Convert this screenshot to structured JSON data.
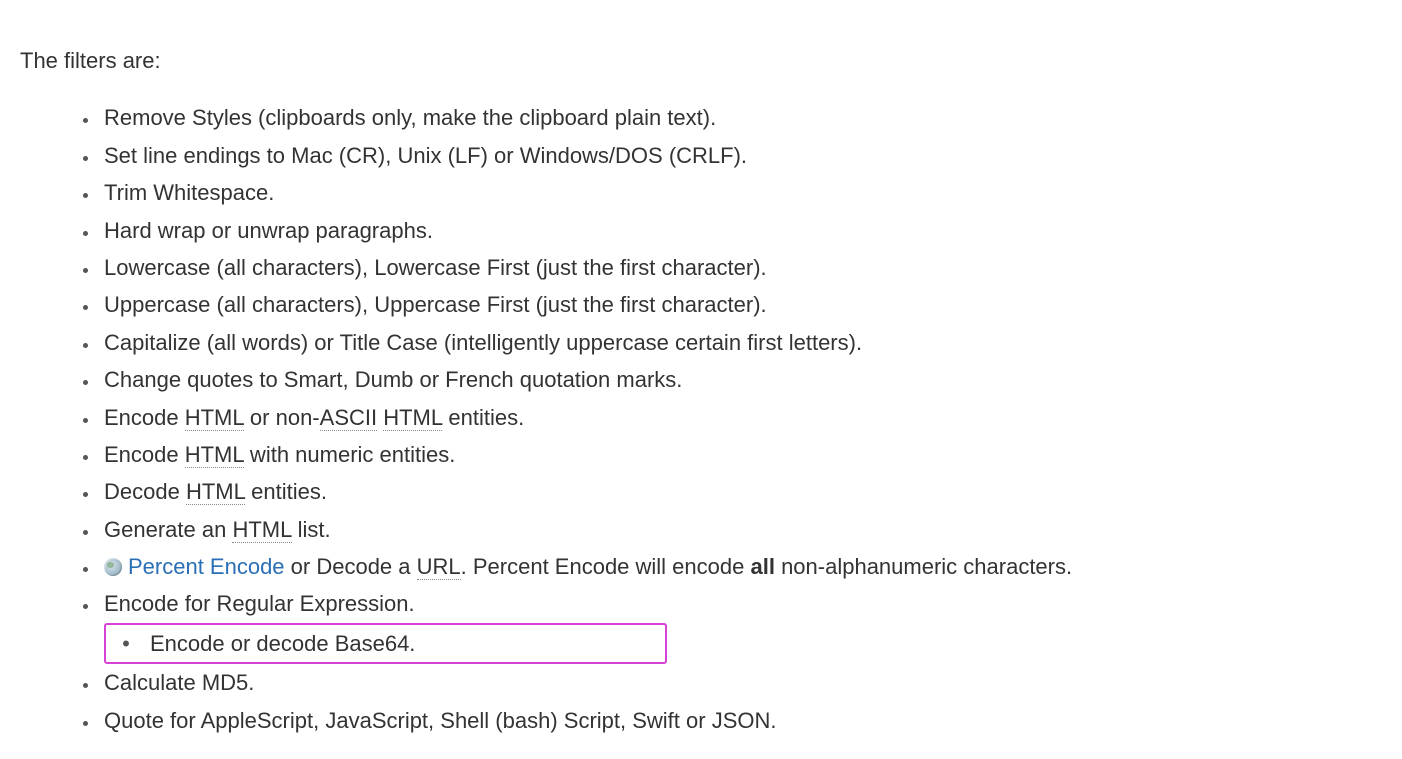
{
  "intro": "The filters are:",
  "items": [
    {
      "segments": [
        {
          "t": "Remove Styles (clipboards only, make the clipboard plain text)."
        }
      ]
    },
    {
      "segments": [
        {
          "t": "Set line endings to Mac (CR), Unix (LF) or Windows/DOS (CRLF)."
        }
      ]
    },
    {
      "segments": [
        {
          "t": "Trim Whitespace."
        }
      ]
    },
    {
      "segments": [
        {
          "t": "Hard wrap or unwrap paragraphs."
        }
      ]
    },
    {
      "segments": [
        {
          "t": "Lowercase (all characters), Lowercase First (just the first character)."
        }
      ]
    },
    {
      "segments": [
        {
          "t": "Uppercase (all characters), Uppercase First (just the first character)."
        }
      ]
    },
    {
      "segments": [
        {
          "t": "Capitalize (all words) or Title Case (intelligently uppercase certain first letters)."
        }
      ]
    },
    {
      "segments": [
        {
          "t": "Change quotes to Smart, Dumb or French quotation marks."
        }
      ]
    },
    {
      "segments": [
        {
          "t": "Encode "
        },
        {
          "t": "HTML",
          "abbr": true
        },
        {
          "t": " or non-"
        },
        {
          "t": "ASCII",
          "abbr": true
        },
        {
          "t": " "
        },
        {
          "t": "HTML",
          "abbr": true
        },
        {
          "t": " entities."
        }
      ]
    },
    {
      "segments": [
        {
          "t": "Encode "
        },
        {
          "t": "HTML",
          "abbr": true
        },
        {
          "t": " with numeric entities."
        }
      ]
    },
    {
      "segments": [
        {
          "t": "Decode "
        },
        {
          "t": "HTML",
          "abbr": true
        },
        {
          "t": " entities."
        }
      ]
    },
    {
      "segments": [
        {
          "t": "Generate an "
        },
        {
          "t": "HTML",
          "abbr": true
        },
        {
          "t": " list."
        }
      ]
    },
    {
      "hasGlobe": true,
      "segments": [
        {
          "t": "Percent Encode",
          "link": true
        },
        {
          "t": " or Decode a "
        },
        {
          "t": "URL",
          "abbr": true
        },
        {
          "t": ". Percent Encode will encode "
        },
        {
          "t": "all",
          "bold": true
        },
        {
          "t": " non-alphanumeric characters."
        }
      ]
    },
    {
      "segments": [
        {
          "t": "Encode for Regular Expression."
        }
      ]
    },
    {
      "highlighted": true,
      "segments": [
        {
          "t": "Encode or decode Base64."
        }
      ]
    },
    {
      "segments": [
        {
          "t": "Calculate MD5."
        }
      ]
    },
    {
      "segments": [
        {
          "t": "Quote for AppleScript, JavaScript, Shell (bash) Script, Swift or JSON."
        }
      ]
    }
  ]
}
